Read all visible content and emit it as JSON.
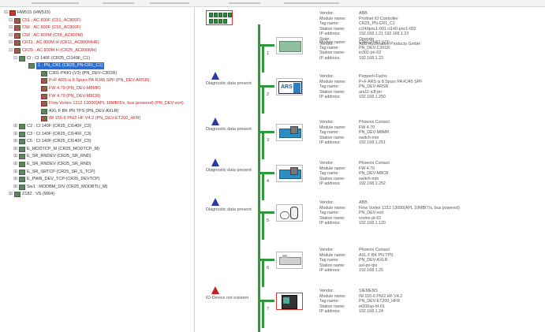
{
  "tree": {
    "items": [
      {
        "label": "HW515 (HW515)",
        "level": 0,
        "color": "normal",
        "icon": "root"
      },
      {
        "label": "C51 : AC 800F (C51_AC800F)",
        "level": 1,
        "color": "red",
        "icon": "device"
      },
      {
        "label": "C56 : AC 800F (C56_AC800F)",
        "level": 1,
        "color": "red",
        "icon": "device"
      },
      {
        "label": "C58 : AC 800M (C58_AC800M)",
        "level": 1,
        "color": "red",
        "icon": "device"
      },
      {
        "label": "CR11 : AC 800M H (CR11_AC800MHR)",
        "level": 1,
        "color": "red",
        "icon": "device"
      },
      {
        "label": "CR25 : AC 800M H (CR25_AC800MH)",
        "level": 1,
        "color": "red",
        "icon": "device"
      },
      {
        "label": "CI : CI 140F (CR25_CI140F_C1)",
        "level": 2,
        "color": "normal",
        "icon": "device"
      },
      {
        "label": "1 : PN_CR1 (CR25_PN-CR1_C1)",
        "level": 3,
        "color": "selected",
        "icon": "device"
      },
      {
        "label": "C301-PNIO (V3) (PN_DEV-C301R)",
        "level": 4,
        "color": "normal",
        "icon": "device"
      },
      {
        "label": "P+F ARS is 8 Spurs PA RJ45 SPF (PN_DEV-ARSR)",
        "level": 4,
        "color": "red",
        "icon": "device"
      },
      {
        "label": "FW 4.70 (PN_DEV-M8MR)",
        "level": 4,
        "color": "red",
        "icon": "device"
      },
      {
        "label": "FW 4.70 (PN_DEV-M8CR)",
        "level": 4,
        "color": "red",
        "icon": "device"
      },
      {
        "label": "Flow Vortex 1212 13000(APL 10MBIT/s, bus powered) (PN_DEV-vort)",
        "level": 4,
        "color": "red",
        "icon": "device"
      },
      {
        "label": "AXL F BK PN TPS (PN_DEV-AXLR)",
        "level": 4,
        "color": "normal",
        "icon": "device"
      },
      {
        "label": "IM 155-6 PN/2 HF V4.2 (PN_DEV-ET200_HFR)",
        "level": 4,
        "color": "red",
        "icon": "device"
      },
      {
        "label": "C2 : CI 140F (CR25_CI140F_C2)",
        "level": 2,
        "color": "normal",
        "icon": "device"
      },
      {
        "label": "C3 : CI 140F (CR25_CI140F_C3)",
        "level": 2,
        "color": "normal",
        "icon": "device"
      },
      {
        "label": "C5 : CI 140F (CR25_CI140F_C5)",
        "level": 2,
        "color": "normal",
        "icon": "device"
      },
      {
        "label": "E_MODTCP_M (CR25_MODTCP_M)",
        "level": 2,
        "color": "normal",
        "icon": "device"
      },
      {
        "label": "E_SR_RNDEV (CR25_SR_RND)",
        "level": 2,
        "color": "normal",
        "icon": "device"
      },
      {
        "label": "E_SR_RNDEV (CR25_SR_RND)",
        "level": 2,
        "color": "normal",
        "icon": "device"
      },
      {
        "label": "E_SR_SRTCP (CR25_SR_S_TCP)",
        "level": 2,
        "color": "normal",
        "icon": "device"
      },
      {
        "label": "E_PWR_DEV_TCP (CR25_DEVTCP)",
        "level": 2,
        "color": "normal",
        "icon": "device"
      },
      {
        "label": "Sw1 : MODBM_DIV (CR25_MODBTU_M)",
        "level": 2,
        "color": "normal",
        "icon": "device"
      },
      {
        "label": "Z182 : VS (W64)",
        "level": 1,
        "color": "normal",
        "icon": "device"
      }
    ]
  },
  "controller": {
    "labels": [
      "Vendor:",
      "Module name:",
      "Tag name:",
      "Station name:",
      "IP address:",
      "State:",
      "Vendor:"
    ],
    "values": [
      "ABB",
      "Profinet IO Controller",
      "CR25_PN-CR1_C1",
      "ci140pnc1-001 ci140-pnc1-002",
      "192.168.1.21 192.168.1.22",
      "Operate",
      "ABB Automation Products GmbH"
    ]
  },
  "devices": [
    {
      "slot": "1",
      "status": "",
      "status_color": "",
      "icon": "abb-io-module-icon",
      "labels": [
        "Module name:",
        "Tag name:",
        "Station name:",
        "IP address:"
      ],
      "values": [
        "C301-PNIO (V3)",
        "PN_DEV-C301R",
        "io301-pn-02",
        "192.168.1.23"
      ]
    },
    {
      "slot": "2",
      "status": "Diagnostic data present",
      "status_color": "blue",
      "icon": "ars-coupler-icon",
      "labels": [
        "Vendor:",
        "Module name:",
        "Tag name:",
        "Station name:",
        "IP address:"
      ],
      "values": [
        "Pepperl+Fuchs",
        "P+F ARS is 8 Spurs PA RJ45 SPF",
        "PN_DEV-ARSR",
        "ars11-ic8-pn",
        "192.168.1.250"
      ]
    },
    {
      "slot": "3",
      "status": "Diagnostic data present",
      "status_color": "blue",
      "icon": "switch-icon",
      "labels": [
        "Vendor:",
        "Module name:",
        "Tag name:",
        "Station name:",
        "IP address:"
      ],
      "values": [
        "Phoenix Contact",
        "FW 4.70",
        "PN_DEV-M8MR",
        "switch-mm",
        "192.168.1.251"
      ]
    },
    {
      "slot": "4",
      "status": "Diagnostic data present",
      "status_color": "blue",
      "icon": "switch-icon",
      "labels": [
        "Vendor:",
        "Module name:",
        "Tag name:",
        "Station name:",
        "IP address:"
      ],
      "values": [
        "Phoenix Contact",
        "FW 4.70",
        "PN_DEV-M8CR",
        "switch-mm",
        "192.168.1.252"
      ]
    },
    {
      "slot": "5",
      "status": "Diagnostic data present",
      "status_color": "blue",
      "icon": "flowmeter-icon",
      "labels": [
        "Vendor:",
        "Module name:",
        "Tag name:",
        "Station name:",
        "IP address:"
      ],
      "values": [
        "ABB",
        "Flow Vortex 1212 13000(APL 10MBIT/s, bus powered)",
        "PN_DEV-vort",
        "vortex-pt-01",
        "192.168.1.120"
      ]
    },
    {
      "slot": "6",
      "status": "",
      "status_color": "",
      "icon": "bus-coupler-icon",
      "labels": [
        "Vendor:",
        "Module name:",
        "Tag name:",
        "Station name:",
        "IP address:"
      ],
      "values": [
        "Phoenix Contact",
        "AXL F BK PN TPS",
        "PN_DEV-AXLR",
        "axl-pn-tps",
        "192.168.1.25"
      ]
    },
    {
      "slot": "7",
      "status": "IO-Device not existent",
      "status_color": "red",
      "icon": "et200-icon",
      "labels": [
        "Vendor:",
        "Module name:",
        "Tag name:",
        "Station name:",
        "IP address:"
      ],
      "values": [
        "SIEMENS",
        "IM 155-6 PN/2 HF V4.2",
        "PN_DEV-ET200_HFR",
        "et200sp-hf-01",
        "192.168.1.24"
      ]
    }
  ],
  "colors": {
    "bus_line": "#2e9a3a",
    "error_red": "#d12020",
    "diag_blue": "#2a3aa0",
    "selection": "#2a6fd6"
  }
}
